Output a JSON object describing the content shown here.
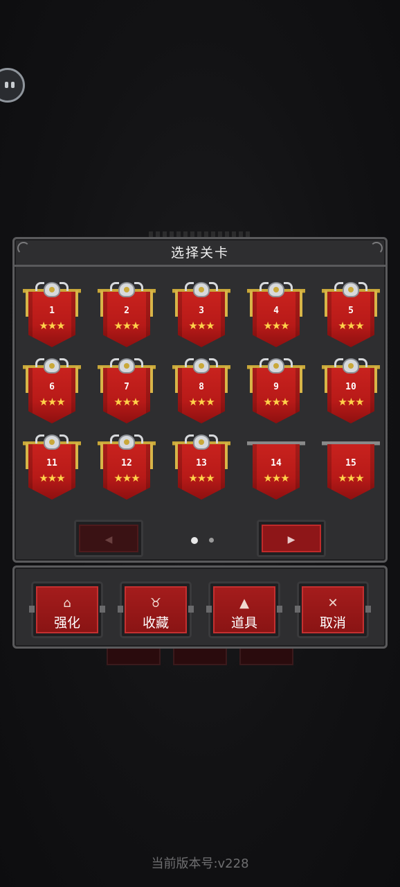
{
  "dialog": {
    "title": "选择关卡"
  },
  "levels": [
    {
      "number": "1",
      "stars": "★★★",
      "unlocked": true
    },
    {
      "number": "2",
      "stars": "★★★",
      "unlocked": true
    },
    {
      "number": "3",
      "stars": "★★★",
      "unlocked": true
    },
    {
      "number": "4",
      "stars": "★★★",
      "unlocked": true
    },
    {
      "number": "5",
      "stars": "★★★",
      "unlocked": true
    },
    {
      "number": "6",
      "stars": "★★★",
      "unlocked": true
    },
    {
      "number": "7",
      "stars": "★★★",
      "unlocked": true
    },
    {
      "number": "8",
      "stars": "★★★",
      "unlocked": true
    },
    {
      "number": "9",
      "stars": "★★★",
      "unlocked": true
    },
    {
      "number": "10",
      "stars": "★★★",
      "unlocked": true
    },
    {
      "number": "11",
      "stars": "★★★",
      "unlocked": true
    },
    {
      "number": "12",
      "stars": "★★★",
      "unlocked": true
    },
    {
      "number": "13",
      "stars": "★★★",
      "unlocked": true
    },
    {
      "number": "14",
      "stars": "★★★",
      "unlocked": false
    },
    {
      "number": "15",
      "stars": "★★★",
      "unlocked": false
    }
  ],
  "pagination": {
    "prev_icon": "◀",
    "next_icon": "▶",
    "current_page": 1,
    "total_pages": 2
  },
  "actions": [
    {
      "label": "强化",
      "icon": "⌂",
      "icon_name": "upgrade-icon"
    },
    {
      "label": "收藏",
      "icon": "♉",
      "icon_name": "trophy-icon"
    },
    {
      "label": "道具",
      "icon": "▲",
      "icon_name": "potion-icon"
    },
    {
      "label": "取消",
      "icon": "✕",
      "icon_name": "close-icon"
    }
  ],
  "footer": {
    "version_text": "当前版本号:v228"
  },
  "colors": {
    "banner_red": "#c8221e",
    "star_gold": "#ffd24a",
    "panel_bg": "#2e2e30",
    "button_red": "#a41c1c"
  }
}
